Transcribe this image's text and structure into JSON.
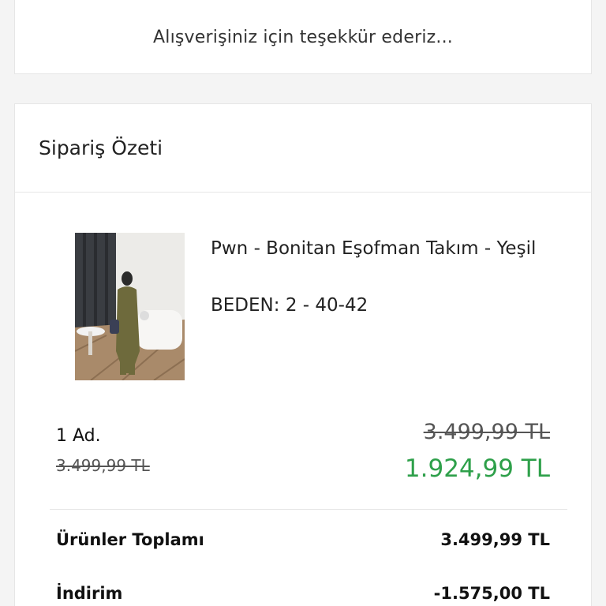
{
  "thanks": {
    "text": "Alışverişiniz için teşekkür ederiz..."
  },
  "summary": {
    "title": "Sipariş Özeti",
    "item": {
      "name": "Pwn - Bonitan Eşofman Takım - Yeşil",
      "size": "BEDEN: 2 - 40-42",
      "quantity": "1 Ad.",
      "unit_old_price": "3.499,99 TL",
      "old_price": "3.499,99 TL",
      "new_price": "1.924,99 TL",
      "image_icon": "product-photo"
    },
    "totals": {
      "products_label": "Ürünler Toplamı",
      "products_value": "3.499,99 TL",
      "discount_label": "İndirim",
      "discount_value": "-1.575,00 TL"
    }
  },
  "colors": {
    "discount_price": "#2ea04a",
    "border": "#e6e6e6"
  }
}
